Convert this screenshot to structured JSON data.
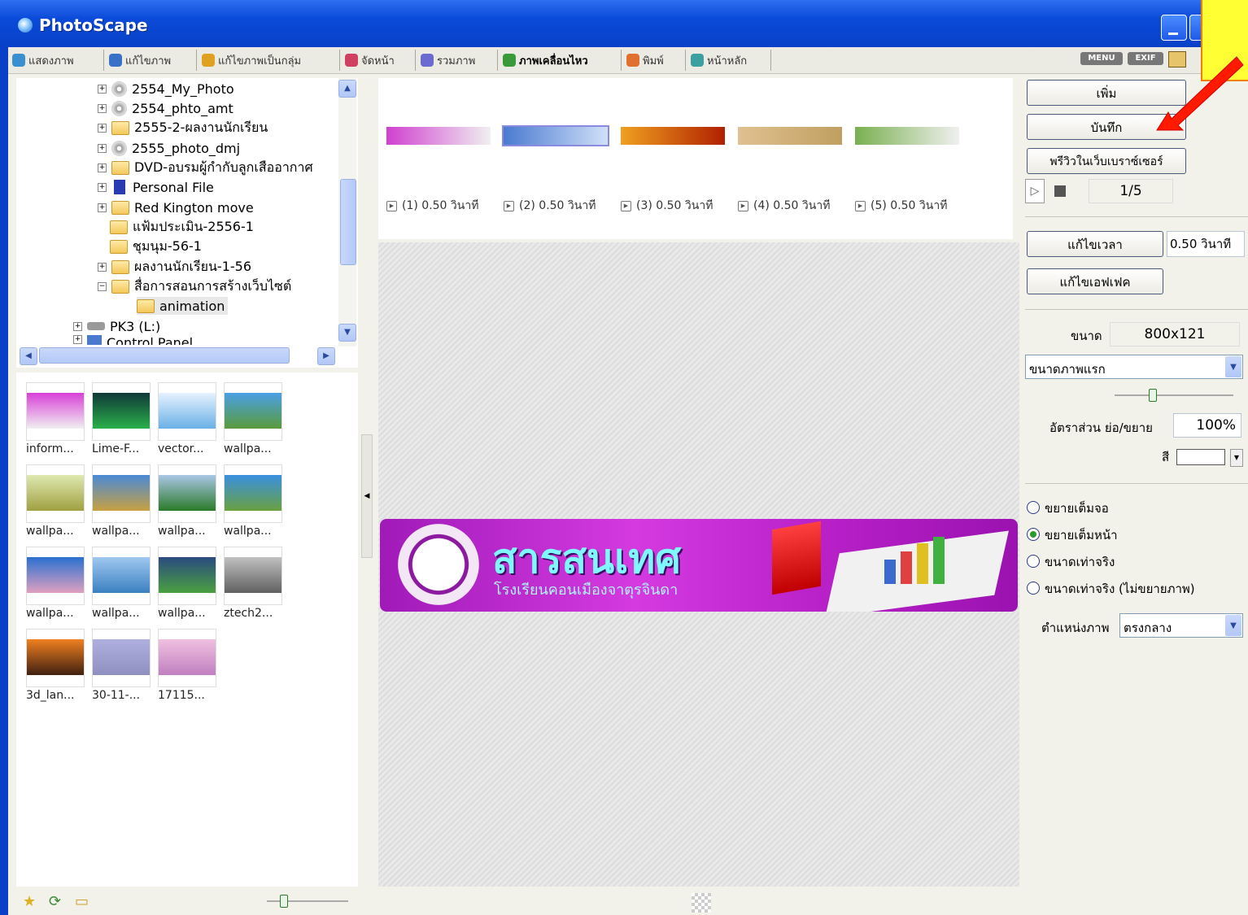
{
  "window": {
    "title": "PhotoScape"
  },
  "tabs": [
    {
      "label": "แสดงภาพ",
      "color": "#3a8fd0"
    },
    {
      "label": "แก้ไขภาพ",
      "color": "#3a70c8"
    },
    {
      "label": "แก้ไขภาพเป็นกลุ่ม",
      "color": "#e0a020"
    },
    {
      "label": "จัดหน้า",
      "color": "#d04060"
    },
    {
      "label": "รวมภาพ",
      "color": "#6a6ad0"
    },
    {
      "label": "ภาพเคลื่อนไหว",
      "color": "#3a9a3a"
    },
    {
      "label": "พิมพ์",
      "color": "#e07030"
    },
    {
      "label": "หน้าหลัก",
      "color": "#3aa0a0"
    }
  ],
  "top_icons": {
    "menu": "MENU",
    "exif": "EXIF"
  },
  "tree": {
    "items": [
      {
        "label": "2554_My_Photo",
        "icon": "disc-icon"
      },
      {
        "label": "2554_phto_amt",
        "icon": "disc-icon"
      },
      {
        "label": "2555-2-ผลงานนักเรียน",
        "icon": "folder-icon"
      },
      {
        "label": "2555_photo_dmj",
        "icon": "disc-icon"
      },
      {
        "label": "DVD-อบรมผู้กำกับลูกเสืออากาศ",
        "icon": "folder-icon"
      },
      {
        "label": "Personal File",
        "icon": "file-icon"
      },
      {
        "label": "Red Kington move",
        "icon": "folder-icon"
      },
      {
        "label": "แฟ้มประเมิน-2556-1",
        "icon": "folder-icon"
      },
      {
        "label": "ชุมนุม-56-1",
        "icon": "folder-icon"
      },
      {
        "label": "ผลงานนักเรียน-1-56",
        "icon": "folder-icon"
      },
      {
        "label": "สื่อการสอนการสร้างเว็บไซต์",
        "icon": "folder-icon"
      },
      {
        "label": "animation",
        "icon": "folder-open-icon"
      },
      {
        "label": "PK3 (L:)",
        "icon": "drive-icon"
      },
      {
        "label": "Control Panel",
        "icon": "control-panel-icon"
      }
    ]
  },
  "thumbnails": [
    {
      "label": "inform...",
      "c1": "#d840d8",
      "c2": "#f0f0f0"
    },
    {
      "label": "Lime-F...",
      "c1": "#103838",
      "c2": "#2ab04a"
    },
    {
      "label": "vector...",
      "c1": "#e6f2ff",
      "c2": "#6ab0e6"
    },
    {
      "label": "wallpa...",
      "c1": "#4aa0e6",
      "c2": "#5a9a3a"
    },
    {
      "label": "wallpa...",
      "c1": "#dfe9b0",
      "c2": "#a0a040"
    },
    {
      "label": "wallpa...",
      "c1": "#4a8ad6",
      "c2": "#c8a040"
    },
    {
      "label": "wallpa...",
      "c1": "#aac6e6",
      "c2": "#2a7a2a"
    },
    {
      "label": "wallpa...",
      "c1": "#3a90e0",
      "c2": "#6aa040"
    },
    {
      "label": "wallpa...",
      "c1": "#2a70d0",
      "c2": "#e0a0c0"
    },
    {
      "label": "wallpa...",
      "c1": "#a0c8f0",
      "c2": "#3a80c0"
    },
    {
      "label": "wallpa...",
      "c1": "#2a4a80",
      "c2": "#4aa040"
    },
    {
      "label": "ztech2...",
      "c1": "#c0c0c0",
      "c2": "#606060"
    },
    {
      "label": "3d_lan...",
      "c1": "#f08020",
      "c2": "#402010"
    },
    {
      "label": "30-11-...",
      "c1": "#b0b0e0",
      "c2": "#9090c0"
    },
    {
      "label": "17115...",
      "c1": "#f0c0e0",
      "c2": "#c080c0"
    }
  ],
  "frames": [
    {
      "label": "(1) 0.50 วินาที",
      "c1": "#d040d0",
      "c2": "#f0f0f0"
    },
    {
      "label": "(2) 0.50 วินาที",
      "c1": "#4a7ad0",
      "c2": "#d0e0f8"
    },
    {
      "label": "(3) 0.50 วินาที",
      "c1": "#f0a020",
      "c2": "#b02000"
    },
    {
      "label": "(4) 0.50 วินาที",
      "c1": "#e0c090",
      "c2": "#c0a060"
    },
    {
      "label": "(5) 0.50 วินาที",
      "c1": "#7ab050",
      "c2": "#f0f0f0"
    }
  ],
  "banner": {
    "title": "สารสนเทศ",
    "subtitle": "โรงเรียนคอนเมืองจาตุรจินดา"
  },
  "right_panel": {
    "add_label": "เพิ่ม",
    "save_label": "บันทึก",
    "preview_label": "พรีวิวในเว็บเบราซ์เซอร์",
    "frame_counter": "1/5",
    "edit_time_label": "แก้ไขเวลา",
    "time_value": "0.50 วินาที",
    "edit_effect_label": "แก้ไขเอฟเฟค",
    "size_label": "ขนาด",
    "size_value": "800x121",
    "size_mode": "ขนาดภาพแรก",
    "ratio_label": "อัตราส่วน ย่อ/ขยาย",
    "ratio_value": "100%",
    "color_label": "สี",
    "color_value": "#ffffff",
    "radios": [
      {
        "label": "ขยายเต็มจอ",
        "checked": false
      },
      {
        "label": "ขยายเต็มหน้า",
        "checked": true
      },
      {
        "label": "ขนาดเท่าจริง",
        "checked": false
      },
      {
        "label": "ขนาดเท่าจริง (ไม่ขยายภาพ)",
        "checked": false
      }
    ],
    "position_label": "ตำแหน่งภาพ",
    "position_value": "ตรงกลาง"
  }
}
